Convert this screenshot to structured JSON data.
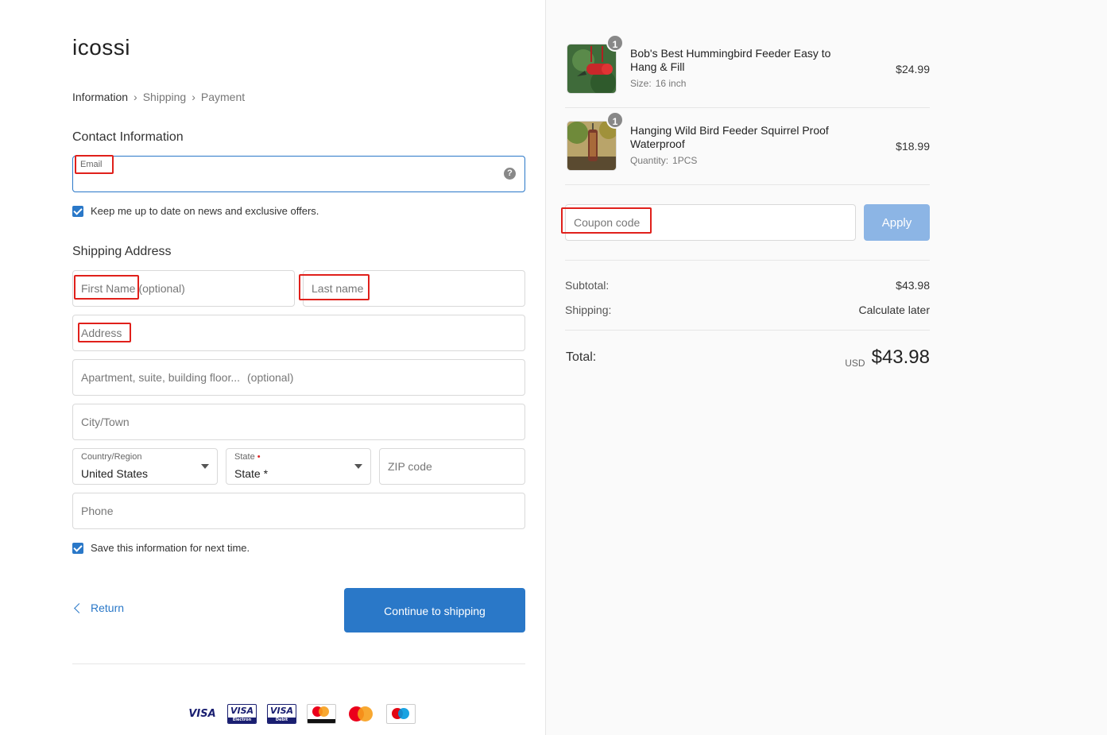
{
  "brand": {
    "logo": "icossi"
  },
  "breadcrumb": {
    "step1": "Information",
    "step2": "Shipping",
    "step3": "Payment"
  },
  "contact": {
    "title": "Contact Information",
    "email_label": "Email",
    "help": "?",
    "newsletter_label": "Keep me up to date on news and exclusive offers."
  },
  "shipping": {
    "title": "Shipping Address",
    "first_name": "First Name",
    "first_name_optional": "(optional)",
    "last_name": "Last name",
    "address": "Address",
    "apartment": "Apartment, suite, building floor...",
    "apartment_optional": "(optional)",
    "city": "City/Town",
    "country_label": "Country/Region",
    "country_value": "United States",
    "state_label": "State",
    "state_value": "State *",
    "zip": "ZIP code",
    "phone": "Phone",
    "save_label": "Save this information for next time."
  },
  "actions": {
    "return": "Return",
    "continue": "Continue to shipping"
  },
  "payment_icons": [
    "visa-icon",
    "visa-electron-icon",
    "visa-debit-icon",
    "mastercard-debit-icon",
    "mastercard-icon",
    "maestro-icon"
  ],
  "payment_text": {
    "visa": "VISA",
    "electron": "Electron",
    "debit": "Debit"
  },
  "cart": {
    "items": [
      {
        "name": "Bob's Best Hummingbird Feeder Easy to Hang & Fill",
        "meta_label": "Size:",
        "meta_value": "16 inch",
        "qty": "1",
        "price": "$24.99",
        "image_icon": "hummingbird-feeder-thumbnail"
      },
      {
        "name": "Hanging Wild Bird Feeder Squirrel Proof Waterproof",
        "meta_label": "Quantity:",
        "meta_value": "1PCS",
        "qty": "1",
        "price": "$18.99",
        "image_icon": "bird-feeder-thumbnail"
      }
    ],
    "coupon_placeholder": "Coupon code",
    "apply": "Apply",
    "subtotal_label": "Subtotal:",
    "subtotal_value": "$43.98",
    "shipping_label": "Shipping:",
    "shipping_value": "Calculate later",
    "total_label": "Total:",
    "currency": "USD",
    "total_value": "$43.98"
  },
  "colors": {
    "accent": "#2a78c8",
    "apply_disabled": "#8cb5e5",
    "highlight_box": "#e0201b",
    "required": "#dd2222"
  }
}
